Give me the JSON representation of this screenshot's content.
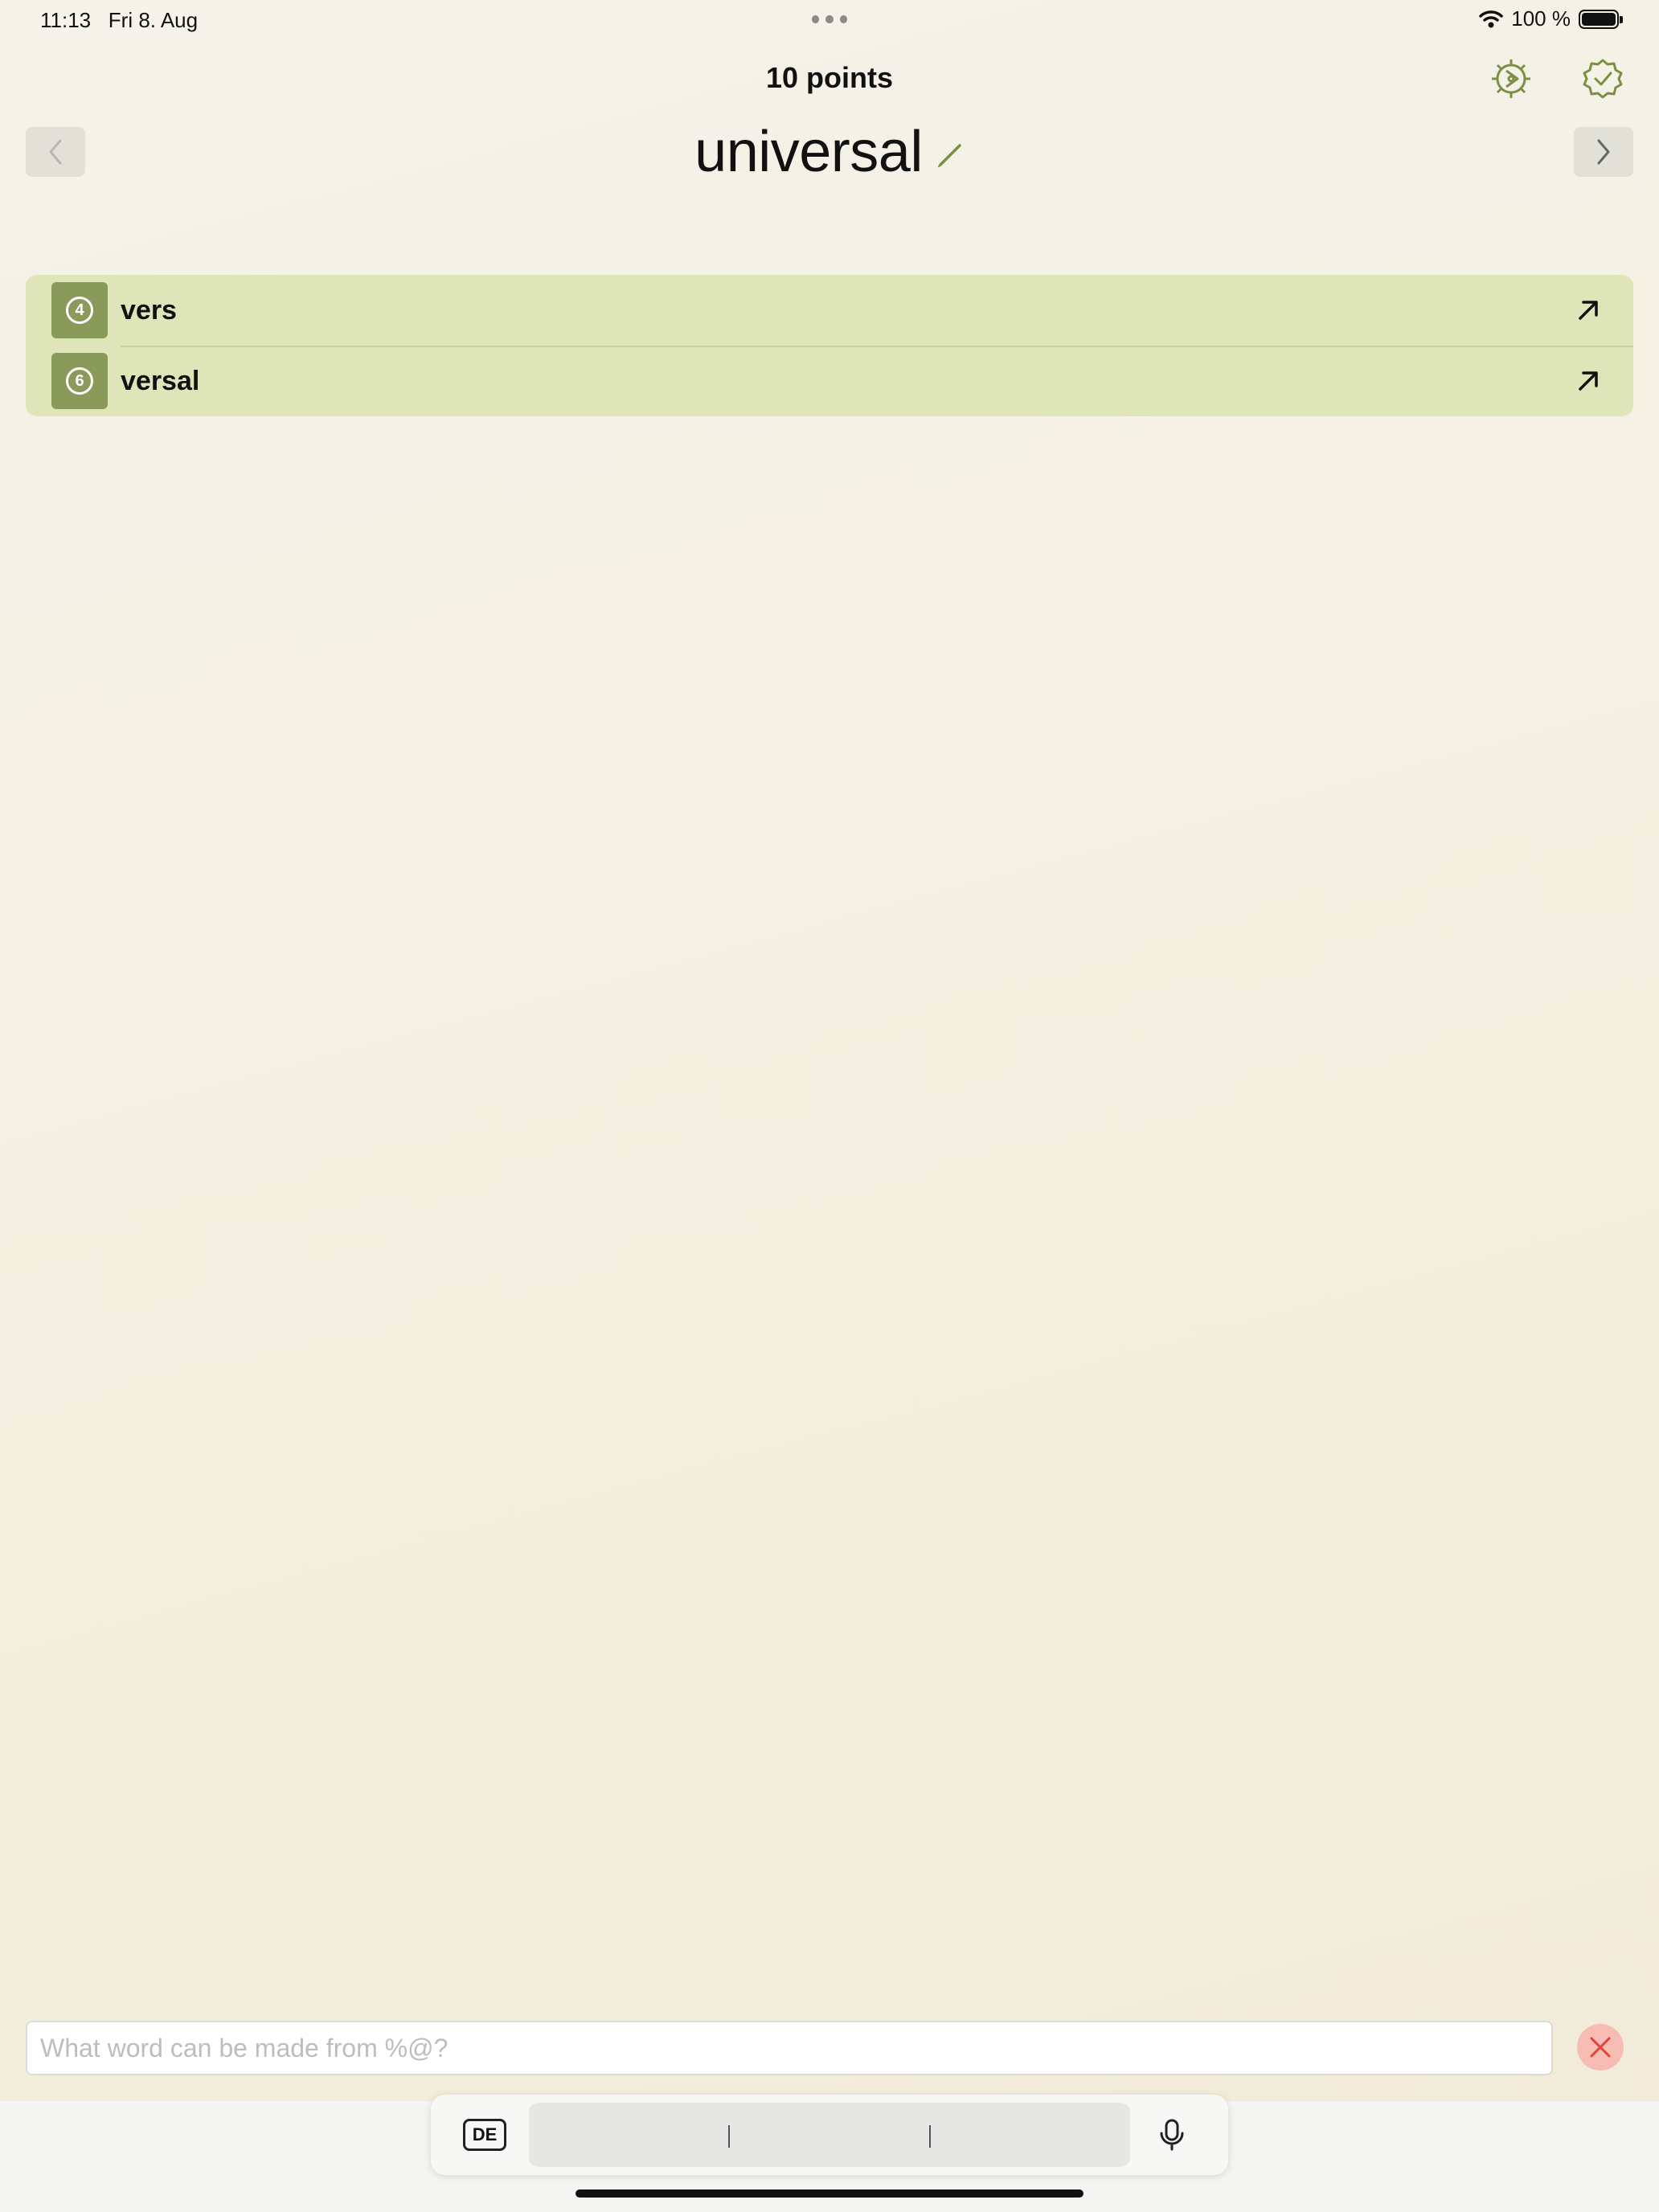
{
  "status_bar": {
    "time_date": "11:13   Fri 8. Aug",
    "battery": "100 %",
    "battery_level": 1.0
  },
  "header": {
    "points": "10 points",
    "title": "universal",
    "icons": {
      "settings": "gear-icon",
      "badge": "checkmark-seal-icon",
      "edit": "pencil-icon",
      "prev": "chevron-left-icon",
      "next": "chevron-right-icon"
    }
  },
  "words": [
    {
      "score": "4",
      "word": "vers"
    },
    {
      "score": "6",
      "word": "versal"
    }
  ],
  "input": {
    "value": "",
    "placeholder": "What word can be made from %@?"
  },
  "keyboard": {
    "language": "DE"
  },
  "colors": {
    "accent": "#7b8f45",
    "list_background": "#dee5b9",
    "score_background": "#8a9a5a",
    "clear_button": "#f6bcb4",
    "clear_x": "#e0443a"
  }
}
